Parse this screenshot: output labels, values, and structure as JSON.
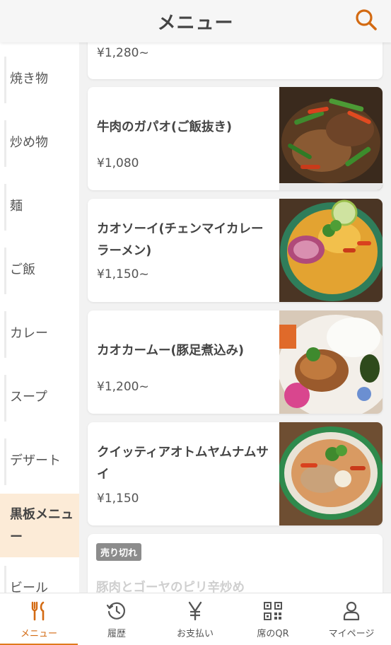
{
  "header": {
    "title": "メニュー",
    "search_icon": "search-icon",
    "accent_color": "#d36a12"
  },
  "sidebar": {
    "items": [
      {
        "label": "焼き物"
      },
      {
        "label": "炒め物"
      },
      {
        "label": "麺"
      },
      {
        "label": "ご飯"
      },
      {
        "label": "カレー"
      },
      {
        "label": "スープ"
      },
      {
        "label": "デザート"
      },
      {
        "label": "黒板メニュー",
        "active": true
      },
      {
        "label": "ビール"
      }
    ],
    "active_bg": "#fcebd7"
  },
  "menu": {
    "items": [
      {
        "name": "",
        "price": "¥1,280~"
      },
      {
        "name": "牛肉のガパオ(ご飯抜き)",
        "price": "¥1,080"
      },
      {
        "name": "カオソーイ(チェンマイカレーラーメン)",
        "price": "¥1,150~"
      },
      {
        "name": "カオカームー(豚足煮込み)",
        "price": "¥1,200~"
      },
      {
        "name": "クイッティアオトムヤムナムサイ",
        "price": "¥1,150"
      }
    ],
    "soldout": {
      "badge": "売り切れ",
      "name": "豚肉とゴーヤのピリ辛炒め"
    }
  },
  "bottom_nav": {
    "items": [
      {
        "label": "メニュー",
        "icon": "fork-knife-icon",
        "active": true
      },
      {
        "label": "履歴",
        "icon": "history-icon"
      },
      {
        "label": "お支払い",
        "icon": "yen-icon"
      },
      {
        "label": "席のQR",
        "icon": "qr-code-icon"
      },
      {
        "label": "マイページ",
        "icon": "person-icon"
      }
    ]
  }
}
